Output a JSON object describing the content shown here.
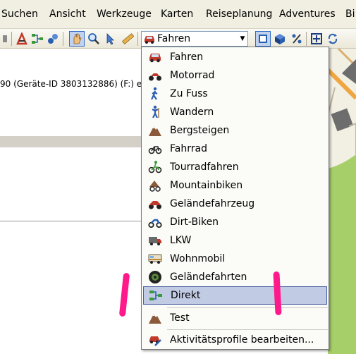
{
  "menubar": {
    "items": [
      "Suchen",
      "Ansicht",
      "Werkzeuge",
      "Karten",
      "Reiseplanung",
      "Adventures",
      "Bi"
    ]
  },
  "toolbar": {
    "selected_profile": "Fahren",
    "icons": [
      "pencil-icon",
      "route-icon",
      "waypoint-icon",
      "hand-icon",
      "zoom-icon",
      "pointer-icon",
      "ruler-icon",
      "car-icon",
      "square-icon",
      "cube-icon",
      "percent-icon",
      "move-icon",
      "sync-icon"
    ]
  },
  "left_panel": {
    "device_text": "90 (Geräte-ID 3803132886) (F:) em"
  },
  "dropdown": {
    "items": [
      {
        "label": "Fahren",
        "icon": "car-icon"
      },
      {
        "label": "Motorrad",
        "icon": "motorcycle-icon"
      },
      {
        "label": "Zu Fuss",
        "icon": "walking-icon"
      },
      {
        "label": "Wandern",
        "icon": "hiking-icon"
      },
      {
        "label": "Bergsteigen",
        "icon": "mountain-icon"
      },
      {
        "label": "Fahrrad",
        "icon": "bicycle-icon"
      },
      {
        "label": "Tourradfahren",
        "icon": "touring-bike-icon"
      },
      {
        "label": "Mountainbiken",
        "icon": "mountain-bike-icon"
      },
      {
        "label": "Geländefahrzeug",
        "icon": "atv-icon"
      },
      {
        "label": "Dirt-Biken",
        "icon": "dirt-bike-icon"
      },
      {
        "label": "LKW",
        "icon": "truck-icon"
      },
      {
        "label": "Wohnmobil",
        "icon": "rv-icon"
      },
      {
        "label": "Geländefahrten",
        "icon": "tire-icon"
      },
      {
        "label": "Direkt",
        "icon": "direct-route-icon",
        "selected": true
      }
    ],
    "custom_items": [
      {
        "label": "Test",
        "icon": "mountain-icon"
      }
    ],
    "footer_item": {
      "label": "Aktivitätsprofile bearbeiten...",
      "icon": "profile-edit-icon"
    }
  },
  "colors": {
    "menubar_bg": "#f1efe2",
    "selection_bg": "#c1cbe4",
    "map_green": "#a6cf6a",
    "map_road": "#f0a640",
    "annotation": "#ff1a8c"
  }
}
